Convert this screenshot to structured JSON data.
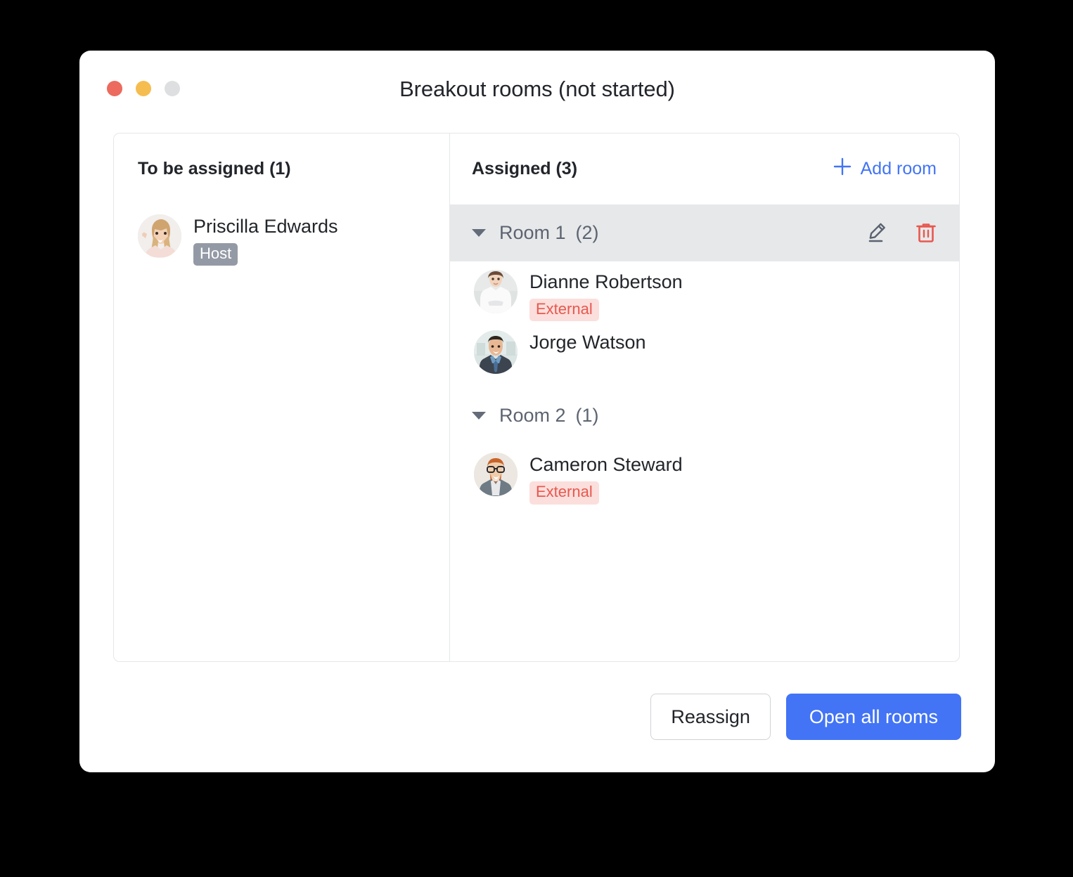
{
  "window": {
    "title": "Breakout rooms (not started)",
    "traffic_lights": [
      {
        "name": "close",
        "color": "#ec6a5e"
      },
      {
        "name": "minimize",
        "color": "#f5bd4f"
      },
      {
        "name": "zoom",
        "color": "#dedfe0"
      }
    ]
  },
  "left_panel": {
    "heading": "To be assigned (1)",
    "people": [
      {
        "name": "Priscilla Edwards",
        "badge": "Host",
        "badge_type": "host",
        "avatar": "woman-blonde-waving"
      }
    ]
  },
  "right_panel": {
    "heading": "Assigned (3)",
    "add_room_label": "Add room",
    "add_room_icon": "plus-icon",
    "rooms": [
      {
        "name": "Room 1",
        "count": "(2)",
        "active": true,
        "caret_icon": "chevron-down-icon",
        "edit_icon": "pencil-icon",
        "delete_icon": "trash-icon",
        "members": [
          {
            "name": "Dianne Robertson",
            "badge": "External",
            "badge_type": "external",
            "avatar": "woman-arms-crossed"
          },
          {
            "name": "Jorge Watson",
            "badge": "",
            "badge_type": "",
            "avatar": "man-suit-tie"
          }
        ]
      },
      {
        "name": "Room 2",
        "count": "(1)",
        "active": false,
        "caret_icon": "chevron-down-icon",
        "members": [
          {
            "name": "Cameron Steward",
            "badge": "External",
            "badge_type": "external",
            "avatar": "man-glasses-beard"
          }
        ]
      }
    ]
  },
  "footer": {
    "reassign_label": "Reassign",
    "open_all_label": "Open all rooms"
  },
  "colors": {
    "accent_blue": "#4274f5",
    "external_red": "#e8584f",
    "external_bg": "#fbdfdc",
    "host_gray": "#949aa5",
    "active_row": "#e7e8e9"
  }
}
